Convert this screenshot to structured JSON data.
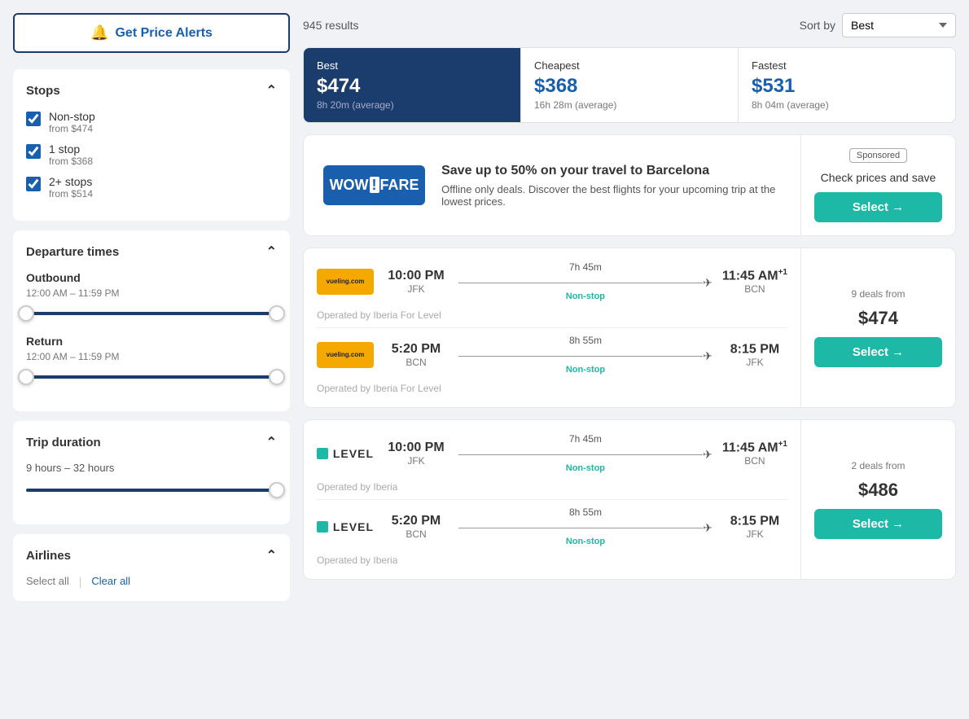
{
  "sidebar": {
    "price_alert_label": "Get Price Alerts",
    "stops_section": {
      "title": "Stops",
      "options": [
        {
          "id": "nonstop",
          "label": "Non-stop",
          "sublabel": "from $474",
          "checked": true
        },
        {
          "id": "1stop",
          "label": "1 stop",
          "sublabel": "from $368",
          "checked": true
        },
        {
          "id": "2stops",
          "label": "2+ stops",
          "sublabel": "from $514",
          "checked": true
        }
      ]
    },
    "departure_section": {
      "title": "Departure times",
      "outbound": {
        "label": "Outbound",
        "range": "12:00 AM – 11:59 PM"
      },
      "return": {
        "label": "Return",
        "range": "12:00 AM – 11:59 PM"
      }
    },
    "duration_section": {
      "title": "Trip duration",
      "range": "9 hours – 32 hours"
    },
    "airlines_section": {
      "title": "Airlines",
      "select_all": "Select all",
      "clear_all": "Clear all"
    }
  },
  "main": {
    "results_count": "945 results",
    "sort_label": "Sort by",
    "sort_options": [
      "Best",
      "Cheapest",
      "Fastest"
    ],
    "sort_selected": "Best",
    "price_tabs": [
      {
        "id": "best",
        "label": "Best",
        "price": "$474",
        "duration": "8h 20m (average)",
        "active": true
      },
      {
        "id": "cheapest",
        "label": "Cheapest",
        "price": "$368",
        "duration": "16h 28m (average)",
        "active": false
      },
      {
        "id": "fastest",
        "label": "Fastest",
        "price": "$531",
        "duration": "8h 04m (average)",
        "active": false
      }
    ],
    "sponsored": {
      "logo_text_wow": "WOW!",
      "logo_text_fare": "FARE",
      "title": "Save up to 50% on your travel to Barcelona",
      "description": "Offline only deals. Discover the best flights for your upcoming trip at the lowest prices.",
      "badge": "Sponsored",
      "right_text": "Check prices and save",
      "select_label": "Select →"
    },
    "flights": [
      {
        "id": "flight1",
        "airline": "vueling",
        "airline_display": "vueling.com",
        "outbound": {
          "depart_time": "10:00 PM",
          "depart_airport": "JFK",
          "arrive_time": "11:45 AM",
          "arrive_day_offset": "+1",
          "arrive_airport": "BCN",
          "duration": "7h 45m",
          "stops": "Non-stop"
        },
        "return": {
          "depart_time": "5:20 PM",
          "depart_airport": "BCN",
          "arrive_time": "8:15 PM",
          "arrive_day_offset": "",
          "arrive_airport": "JFK",
          "duration": "8h 55m",
          "stops": "Non-stop"
        },
        "outbound_operated": "Operated by Iberia For Level",
        "return_operated": "Operated by Iberia For Level",
        "deals_label": "9 deals from",
        "price": "$474",
        "select_label": "Select →"
      },
      {
        "id": "flight2",
        "airline": "level",
        "airline_display": "LEVEL",
        "outbound": {
          "depart_time": "10:00 PM",
          "depart_airport": "JFK",
          "arrive_time": "11:45 AM",
          "arrive_day_offset": "+1",
          "arrive_airport": "BCN",
          "duration": "7h 45m",
          "stops": "Non-stop"
        },
        "return": {
          "depart_time": "5:20 PM",
          "depart_airport": "BCN",
          "arrive_time": "8:15 PM",
          "arrive_day_offset": "",
          "arrive_airport": "JFK",
          "duration": "8h 55m",
          "stops": "Non-stop"
        },
        "outbound_operated": "Operated by Iberia",
        "return_operated": "Operated by Iberia",
        "deals_label": "2 deals from",
        "price": "$486",
        "select_label": "Select →"
      }
    ]
  }
}
